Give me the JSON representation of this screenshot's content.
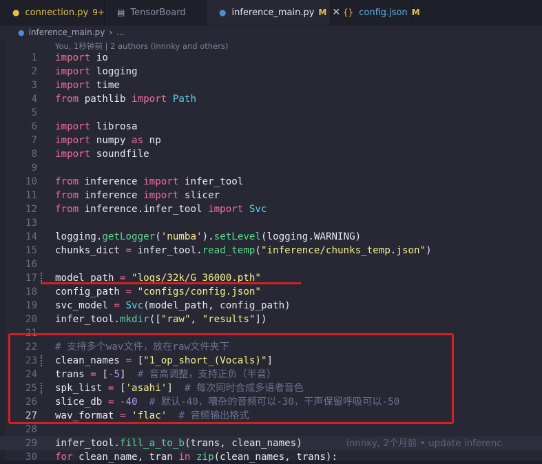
{
  "tabs": [
    {
      "icon": "python-icon",
      "label": "connection.py",
      "badge": "9+",
      "active": false
    },
    {
      "icon": "tensorboard-icon",
      "label": "TensorBoard",
      "active": false
    },
    {
      "icon": "python-icon",
      "label": "inference_main.py",
      "badge": "M",
      "active": true
    },
    {
      "icon": "json-icon",
      "label": "config.json",
      "badge": "M",
      "active": false
    }
  ],
  "breadcrumb": {
    "file": "inference_main.py",
    "separator": "›",
    "more": "..."
  },
  "codelens": "You, 1秒钟前 | 2 authors (innnky and others)",
  "blame_inline": "innnky, 2个月前 • update inferenc",
  "lines": [
    {
      "n": "1",
      "tokens": [
        [
          "kw",
          "import"
        ],
        [
          "plain",
          " io"
        ]
      ]
    },
    {
      "n": "2",
      "tokens": [
        [
          "kw",
          "import"
        ],
        [
          "plain",
          " logging"
        ]
      ]
    },
    {
      "n": "3",
      "tokens": [
        [
          "kw",
          "import"
        ],
        [
          "plain",
          " time"
        ]
      ]
    },
    {
      "n": "4",
      "tokens": [
        [
          "kw",
          "from"
        ],
        [
          "plain",
          " pathlib "
        ],
        [
          "kw",
          "import"
        ],
        [
          "plain",
          " "
        ],
        [
          "cls",
          "Path"
        ]
      ]
    },
    {
      "n": "5",
      "tokens": []
    },
    {
      "n": "6",
      "tokens": [
        [
          "kw",
          "import"
        ],
        [
          "plain",
          " librosa"
        ]
      ]
    },
    {
      "n": "7",
      "tokens": [
        [
          "kw",
          "import"
        ],
        [
          "plain",
          " numpy "
        ],
        [
          "kw",
          "as"
        ],
        [
          "plain",
          " np"
        ]
      ]
    },
    {
      "n": "8",
      "tokens": [
        [
          "kw",
          "import"
        ],
        [
          "plain",
          " soundfile"
        ]
      ]
    },
    {
      "n": "9",
      "tokens": []
    },
    {
      "n": "10",
      "tokens": [
        [
          "kw",
          "from"
        ],
        [
          "plain",
          " inference "
        ],
        [
          "kw",
          "import"
        ],
        [
          "plain",
          " infer_tool"
        ]
      ]
    },
    {
      "n": "11",
      "tokens": [
        [
          "kw",
          "from"
        ],
        [
          "plain",
          " inference "
        ],
        [
          "kw",
          "import"
        ],
        [
          "plain",
          " slicer"
        ]
      ]
    },
    {
      "n": "12",
      "tokens": [
        [
          "kw",
          "from"
        ],
        [
          "plain",
          " inference.infer_tool "
        ],
        [
          "kw",
          "import"
        ],
        [
          "plain",
          " "
        ],
        [
          "cls",
          "Svc"
        ]
      ]
    },
    {
      "n": "13",
      "tokens": []
    },
    {
      "n": "14",
      "tokens": [
        [
          "plain",
          "logging."
        ],
        [
          "fn",
          "getLogger"
        ],
        [
          "plain",
          "("
        ],
        [
          "str",
          "'numba'"
        ],
        [
          "plain",
          ")."
        ],
        [
          "fn",
          "setLevel"
        ],
        [
          "plain",
          "(logging.WARNING)"
        ]
      ]
    },
    {
      "n": "15",
      "tokens": [
        [
          "plain",
          "chunks_dict "
        ],
        [
          "op",
          "="
        ],
        [
          "plain",
          " infer_tool."
        ],
        [
          "fn",
          "read_temp"
        ],
        [
          "plain",
          "("
        ],
        [
          "str",
          "\"inference/chunks_temp.json\""
        ],
        [
          "plain",
          ")"
        ]
      ]
    },
    {
      "n": "16",
      "tokens": []
    },
    {
      "n": "17",
      "mark": true,
      "tokens": [
        [
          "plain",
          "model_path "
        ],
        [
          "op",
          "="
        ],
        [
          "plain",
          " "
        ],
        [
          "str",
          "\"logs/32k/G_36000.pth\""
        ]
      ]
    },
    {
      "n": "18",
      "tokens": [
        [
          "plain",
          "config_path "
        ],
        [
          "op",
          "="
        ],
        [
          "plain",
          " "
        ],
        [
          "str",
          "\"configs/config.json\""
        ]
      ]
    },
    {
      "n": "19",
      "tokens": [
        [
          "plain",
          "svc_model "
        ],
        [
          "op",
          "="
        ],
        [
          "plain",
          " "
        ],
        [
          "cls",
          "Svc"
        ],
        [
          "plain",
          "(model_path, config_path)"
        ]
      ]
    },
    {
      "n": "20",
      "tokens": [
        [
          "plain",
          "infer_tool."
        ],
        [
          "fn",
          "mkdir"
        ],
        [
          "plain",
          "(["
        ],
        [
          "str",
          "\"raw\""
        ],
        [
          "plain",
          ", "
        ],
        [
          "str",
          "\"results\""
        ],
        [
          "plain",
          "])"
        ]
      ]
    },
    {
      "n": "21",
      "tokens": []
    },
    {
      "n": "22",
      "tokens": [
        [
          "cmt",
          "# 支持多个wav文件，放在raw文件夹下"
        ]
      ]
    },
    {
      "n": "23",
      "mark": true,
      "tokens": [
        [
          "plain",
          "clean_names "
        ],
        [
          "op",
          "="
        ],
        [
          "plain",
          " ["
        ],
        [
          "str",
          "\"1_op_short_(Vocals)\""
        ],
        [
          "plain",
          "]"
        ]
      ]
    },
    {
      "n": "24",
      "tokens": [
        [
          "plain",
          "trans "
        ],
        [
          "op",
          "="
        ],
        [
          "plain",
          " ["
        ],
        [
          "op",
          "-"
        ],
        [
          "num",
          "5"
        ],
        [
          "plain",
          "]  "
        ],
        [
          "cmt",
          "# 音高调整，支持正负（半音）"
        ]
      ]
    },
    {
      "n": "25",
      "mark": true,
      "tokens": [
        [
          "plain",
          "spk_list "
        ],
        [
          "op",
          "="
        ],
        [
          "plain",
          " ["
        ],
        [
          "str",
          "'asahi'"
        ],
        [
          "plain",
          "]  "
        ],
        [
          "cmt",
          "# 每次同时合成多语者音色"
        ]
      ]
    },
    {
      "n": "26",
      "tokens": [
        [
          "plain",
          "slice_db "
        ],
        [
          "op",
          "="
        ],
        [
          "plain",
          " "
        ],
        [
          "op",
          "-"
        ],
        [
          "num",
          "40"
        ],
        [
          "plain",
          "  "
        ],
        [
          "cmt",
          "# 默认-40，嘈杂的音频可以-30，干声保留呼吸可以-50"
        ]
      ]
    },
    {
      "n": "27",
      "current": true,
      "tokens": [
        [
          "plain",
          "wav_format "
        ],
        [
          "op",
          "="
        ],
        [
          "plain",
          " "
        ],
        [
          "str",
          "'flac'"
        ],
        [
          "plain",
          "  "
        ],
        [
          "cmt",
          "# 音频输出格式"
        ]
      ]
    },
    {
      "n": "28",
      "tokens": []
    },
    {
      "n": "29",
      "blame": true,
      "tokens": [
        [
          "plain",
          "infer_tool."
        ],
        [
          "fn",
          "fill_a_to_b"
        ],
        [
          "plain",
          "(trans, clean_names)"
        ]
      ]
    },
    {
      "n": "30",
      "tokens": [
        [
          "kw",
          "for"
        ],
        [
          "plain",
          " clean_name, tran "
        ],
        [
          "kw",
          "in"
        ],
        [
          "plain",
          " "
        ],
        [
          "fn",
          "zip"
        ],
        [
          "plain",
          "(clean_names, trans):"
        ]
      ]
    }
  ],
  "colors": {
    "keyword": "#f26c9b",
    "function": "#5ad98f",
    "string": "#f5ee90",
    "class": "#5fd3e8",
    "number": "#b79bf7",
    "comment": "#6e7190",
    "annotation": "#d42024"
  }
}
